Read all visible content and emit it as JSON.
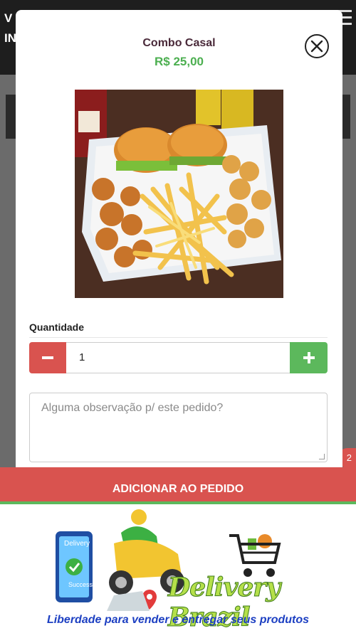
{
  "background": {
    "header_line1": "V",
    "header_line2": "IN",
    "cart_badge": "2"
  },
  "product": {
    "name": "Combo Casal",
    "price": "R$ 25,00"
  },
  "quantity": {
    "label": "Quantidade",
    "value": "1"
  },
  "notes": {
    "placeholder": "Alguma observação p/ este pedido?"
  },
  "actions": {
    "add_label": "ADICIONAR AO PEDIDO"
  },
  "promo": {
    "brand": "Delivery Brazil",
    "phone_text_1": "Delivery",
    "phone_text_2": "Success!",
    "tagline": "Liberdade para vender e entregar seus produtos"
  },
  "colors": {
    "price": "#4caf50",
    "minus": "#d9534f",
    "plus": "#5cb85c",
    "add_button": "#d9534f",
    "tagline": "#1c3fc2"
  },
  "icons": {
    "close": "close-icon",
    "minus": "minus-icon",
    "plus": "plus-icon",
    "menu": "hamburger-icon"
  }
}
